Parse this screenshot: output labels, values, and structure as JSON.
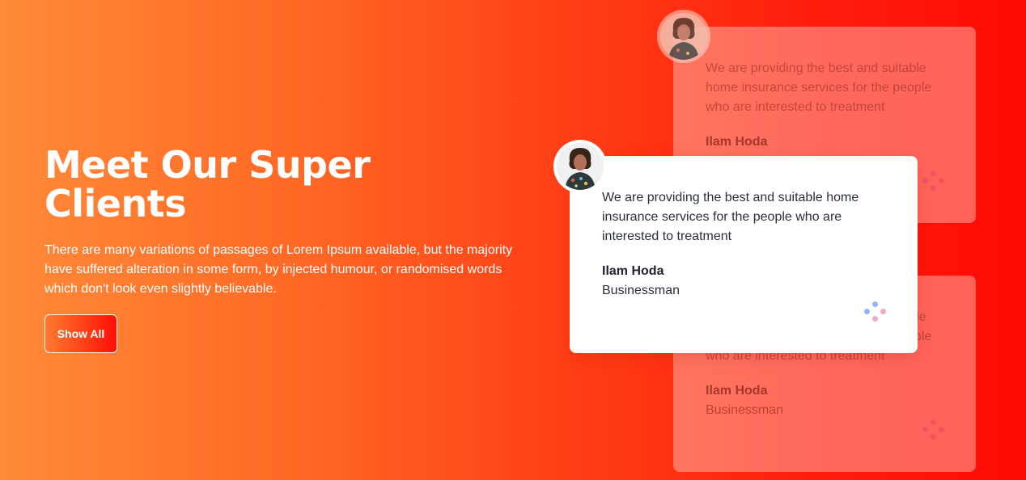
{
  "hero": {
    "title": "Meet Our Super Clients",
    "description": "There are many variations of passages of Lorem Ipsum available, but the majority have suffered alteration in some form, by injected humour, or randomised words which don't look even slightly believable.",
    "button_label": "Show All"
  },
  "testimonials": [
    {
      "quote": "We are providing the best and suitable home insurance services for the people who are interested to treatment",
      "name": "Ilam Hoda",
      "role": "Businessman",
      "avatar_icon": "person-avatar-icon"
    },
    {
      "quote": "We are providing the best and suitable home insurance services for the people who are interested to treatment",
      "name": "Ilam Hoda",
      "role": "Businessman",
      "avatar_icon": "person-avatar-icon"
    },
    {
      "quote": "We are providing the best and suitable home insurance services for the people who are interested to treatment",
      "name": "Ilam Hoda",
      "role": "Businessman",
      "avatar_icon": "person-avatar-icon"
    }
  ],
  "colors": {
    "gradient_start": "#ff8a3a",
    "gradient_end": "#ff0a05",
    "card_bg": "#ffffff",
    "dot_blue": "#8fb5f5",
    "dot_pink": "#f3a6c8"
  }
}
